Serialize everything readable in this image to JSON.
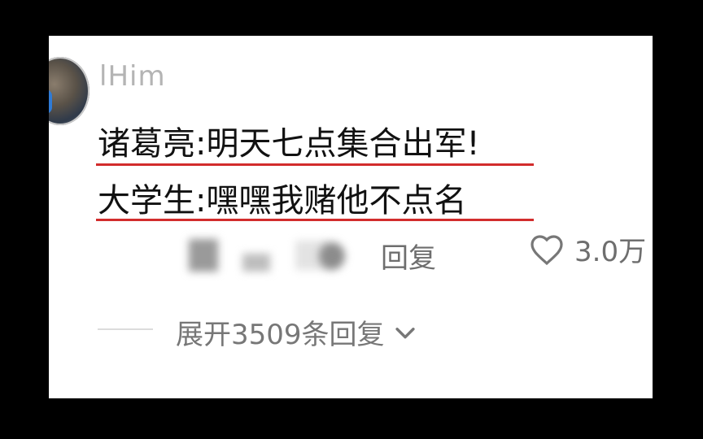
{
  "comment": {
    "username": "lHim",
    "lines": [
      "诸葛亮:明天七点集合出军!",
      "大学生:嘿嘿我赌他不点名"
    ],
    "reply_label": "回复",
    "like_count": "3.0万",
    "expand_label": "展开3509条回复"
  },
  "colors": {
    "underline": "#d22c2c",
    "text": "#111111",
    "muted": "#6e6e6e"
  },
  "icons": {
    "like": "heart-icon",
    "expand": "chevron-down-icon"
  }
}
